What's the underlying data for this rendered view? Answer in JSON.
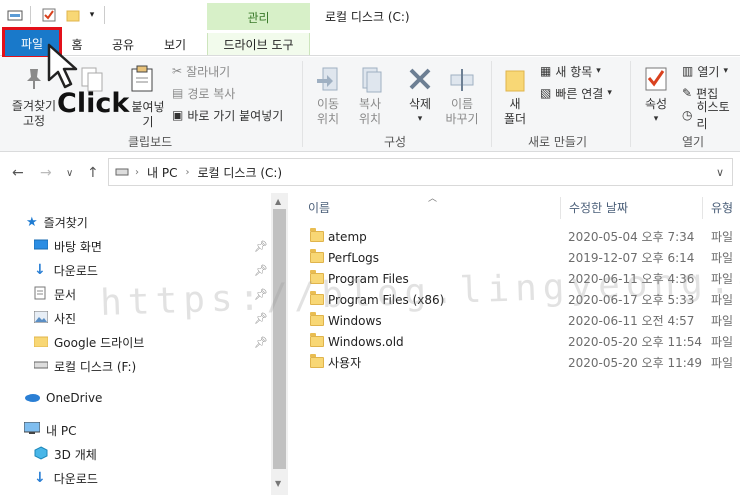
{
  "titlebar": {
    "title": "로컬 디스크 (C:)",
    "manage_label": "관리"
  },
  "tabs": {
    "file": "파일",
    "home": "홈",
    "share": "공유",
    "view": "보기",
    "drive_tools": "드라이브 도구"
  },
  "ribbon": {
    "clipboard": {
      "pin_quick": "즐겨찾기에\n고정",
      "pin_quick_line1": "즐겨찾기",
      "pin_quick_line2": "고정",
      "copy": "복사",
      "paste": "붙여넣기",
      "cut": "잘라내기",
      "copy_path": "경로 복사",
      "paste_shortcut": "바로 가기 붙여넣기",
      "group_label": "클립보드"
    },
    "organize": {
      "move_to_1": "이동",
      "move_to_2": "위치",
      "copy_to_1": "복사",
      "copy_to_2": "위치",
      "delete": "삭제",
      "rename_1": "이름",
      "rename_2": "바꾸기",
      "group_label": "구성"
    },
    "new": {
      "new_folder_1": "새",
      "new_folder_2": "폴더",
      "new_item": "새 항목",
      "easy_access": "빠른 연결",
      "group_label": "새로 만들기"
    },
    "open": {
      "properties": "속성",
      "open": "열기",
      "edit": "편집",
      "history": "히스토리",
      "group_label": "열기"
    }
  },
  "annotation": {
    "click_label": "Click"
  },
  "address": {
    "path_root": "내 PC",
    "path_drive": "로컬 디스크 (C:)"
  },
  "sidebar": {
    "quick_access": "즐겨찾기",
    "items": [
      {
        "label": "바탕 화면",
        "icon": "desktop-icon",
        "pinned": true
      },
      {
        "label": "다운로드",
        "icon": "download-icon",
        "pinned": true
      },
      {
        "label": "문서",
        "icon": "document-icon",
        "pinned": true
      },
      {
        "label": "사진",
        "icon": "pictures-icon",
        "pinned": true
      },
      {
        "label": "Google 드라이브",
        "icon": "folder-icon",
        "pinned": true
      },
      {
        "label": "로컬 디스크 (F:)",
        "icon": "drive-icon",
        "pinned": false
      }
    ],
    "onedrive": "OneDrive",
    "this_pc": "내 PC",
    "pc_items": [
      {
        "label": "3D 개체",
        "icon": "3d-objects-icon"
      },
      {
        "label": "다운로드",
        "icon": "download-icon"
      }
    ]
  },
  "columns": {
    "name": "이름",
    "modified": "수정한 날짜",
    "type": "유형"
  },
  "files": [
    {
      "name": "atemp",
      "date": "2020-05-04 오후 7:34",
      "type": "파일"
    },
    {
      "name": "PerfLogs",
      "date": "2019-12-07 오후 6:14",
      "type": "파일"
    },
    {
      "name": "Program Files",
      "date": "2020-06-11 오후 4:36",
      "type": "파일"
    },
    {
      "name": "Program Files (x86)",
      "date": "2020-06-17 오후 5:33",
      "type": "파일"
    },
    {
      "name": "Windows",
      "date": "2020-06-11 오전 4:57",
      "type": "파일"
    },
    {
      "name": "Windows.old",
      "date": "2020-05-20 오후 11:54",
      "type": "파일"
    },
    {
      "name": "사용자",
      "date": "2020-05-20 오후 11:49",
      "type": "파일"
    }
  ],
  "watermark": "https://blog.lingyeong.com/",
  "colors": {
    "file_tab": "#1979ca",
    "highlight_border": "#e3101a",
    "manage_tab": "#d7f0c8",
    "folder": "#f8d775"
  }
}
